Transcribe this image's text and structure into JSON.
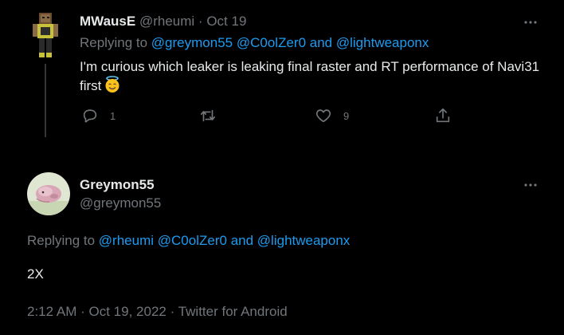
{
  "reply_tweet": {
    "author_name": "MWausE",
    "handle": "@rheumi",
    "separator": "·",
    "date": "Oct 19",
    "replying_prefix": "Replying to",
    "replying_to": [
      "@greymon55",
      "@C0olZer0"
    ],
    "replying_conjunction": "and",
    "replying_last": "@lightweaponx",
    "text": "I'm curious which leaker is leaking final raster and RT performance of Navi31 first",
    "emoji": "smiling-face-with-halo-icon",
    "reply_count": "1",
    "retweet_count": "",
    "like_count": "9"
  },
  "main_tweet": {
    "author_name": "Greymon55",
    "handle": "@greymon55",
    "replying_prefix": "Replying to",
    "replying_to": [
      "@rheumi",
      "@C0olZer0"
    ],
    "replying_conjunction": "and",
    "replying_last": "@lightweaponx",
    "text": "2X",
    "time": "2:12 AM",
    "separator": "·",
    "date": "Oct 19, 2022",
    "source": "Twitter for Android"
  },
  "colors": {
    "background": "#000000",
    "text": "#e7e9ea",
    "muted": "#71767b",
    "link": "#1d9bf0",
    "thread_line": "#333639"
  }
}
